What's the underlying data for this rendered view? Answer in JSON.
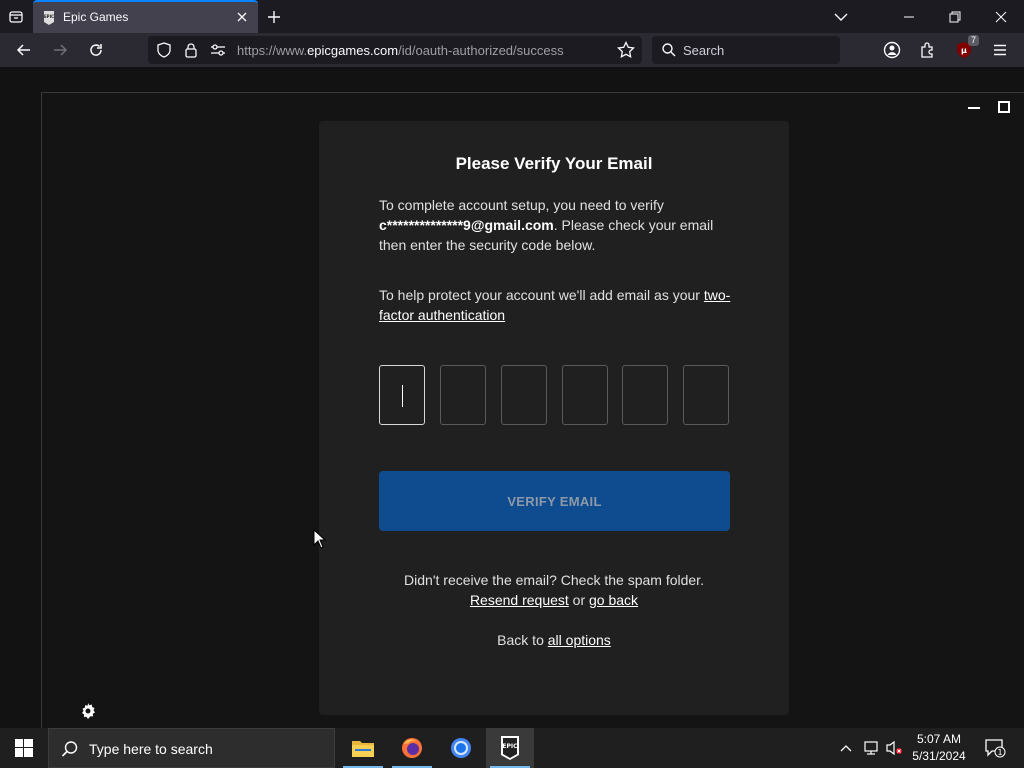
{
  "browser": {
    "tab_title": "Epic Games",
    "url_prefix": "https://www.",
    "url_domain": "epicgames.com",
    "url_path": "/id/oauth-authorized/success",
    "search_placeholder": "Search",
    "extension_badge": "7"
  },
  "card": {
    "title": "Please Verify Your Email",
    "para1_start": "To complete account setup, you need to verify ",
    "email": "c**************9@gmail.com",
    "para1_end": ". Please check your email then enter the security code below.",
    "para2_start": "To help protect your account we'll add email as your ",
    "two_factor_link": "two-factor authentication",
    "code_boxes": 6,
    "verify_button": "VERIFY EMAIL",
    "no_email_text": "Didn't receive the email? Check the spam folder.",
    "resend_link": "Resend request",
    "or_text": " or ",
    "go_back_link": "go back",
    "back_to_text": "Back to ",
    "all_options_link": "all options"
  },
  "taskbar": {
    "search_placeholder": "Type here to search",
    "time": "5:07 AM",
    "date": "5/31/2024",
    "notification_count": "1"
  },
  "colors": {
    "accent": "#0a84ff",
    "verify_button": "#0e4c8f",
    "card_bg": "#202020"
  }
}
